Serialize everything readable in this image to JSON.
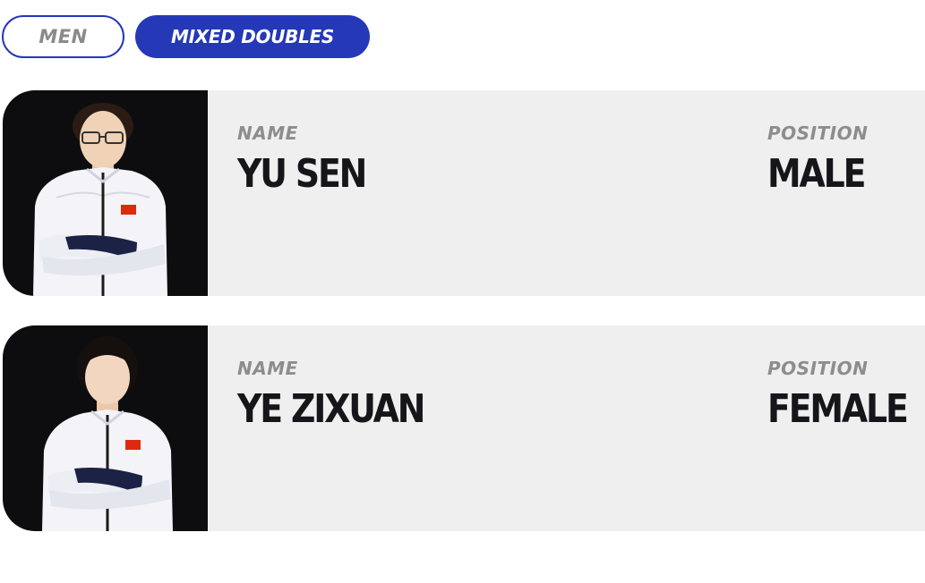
{
  "tabs": [
    {
      "label": "MEN",
      "active": false
    },
    {
      "label": "MIXED DOUBLES",
      "active": true
    }
  ],
  "players": [
    {
      "name_label": "NAME",
      "name": "YU SEN",
      "position_label": "POSITION",
      "position": "MALE"
    },
    {
      "name_label": "NAME",
      "name": "YE ZIXUAN",
      "position_label": "POSITION",
      "position": "FEMALE"
    }
  ],
  "colors": {
    "accent": "#2438b8",
    "card_background": "#efefef",
    "photo_background": "#0d0d0f",
    "label_text": "#8d8d8d",
    "value_text": "#15151a"
  }
}
